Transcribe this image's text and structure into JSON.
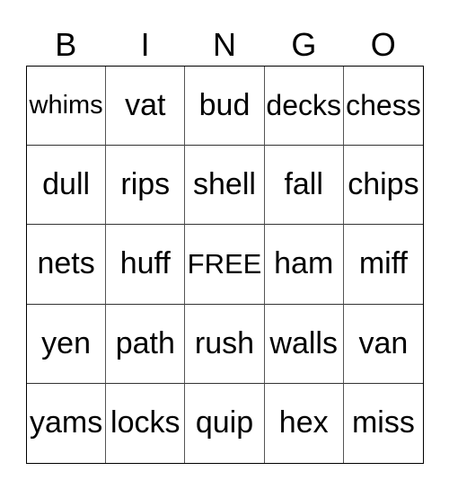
{
  "header": [
    "B",
    "I",
    "N",
    "G",
    "O"
  ],
  "rows": [
    [
      "whims",
      "vat",
      "bud",
      "decks",
      "chess"
    ],
    [
      "dull",
      "rips",
      "shell",
      "fall",
      "chips"
    ],
    [
      "nets",
      "huff",
      "FREE",
      "ham",
      "miff"
    ],
    [
      "yen",
      "path",
      "rush",
      "walls",
      "van"
    ],
    [
      "yams",
      "locks",
      "quip",
      "hex",
      "miss"
    ]
  ]
}
